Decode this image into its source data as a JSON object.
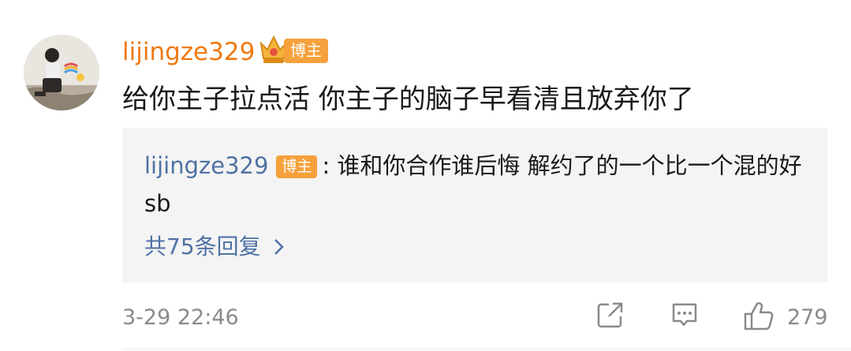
{
  "comment": {
    "username": "lijingze329",
    "badge": "博主",
    "text": "给你主子拉点活 你主子的脑子早看清且放弃你了",
    "timestamp": "3-29 22:46",
    "likes": "279"
  },
  "reply": {
    "username": "lijingze329",
    "badge": "博主",
    "text": ": 谁和你合作谁后悔 解约了的一个比一个混的好 sb",
    "more_label": "共75条回复"
  },
  "colors": {
    "username": "#ef7a12",
    "link": "#4f72a4",
    "badge": "#f6a13c",
    "meta": "#8a8a8a"
  },
  "icons": [
    "crown-vip-icon",
    "chevron-right-icon",
    "share-icon",
    "comment-icon",
    "like-icon"
  ]
}
